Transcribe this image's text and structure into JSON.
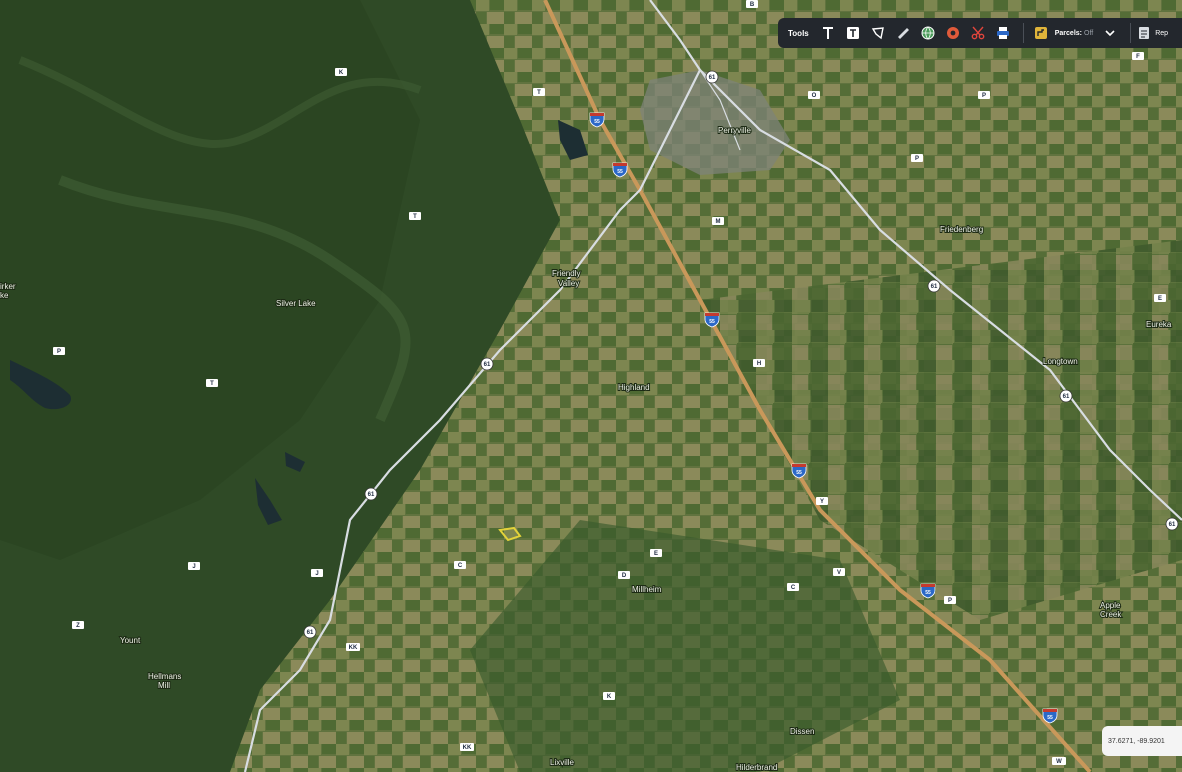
{
  "toolbar": {
    "tools_label": "Tools",
    "parcels_label": "Parcels:",
    "parcels_state": "Off",
    "report_label": "Rep"
  },
  "coords": {
    "text": "37.6271, -89.9201"
  },
  "places": {
    "perryville": "Perryville",
    "friedenberg": "Friedenberg",
    "friendly_valley_1": "Friendly",
    "friendly_valley_2": "Valley",
    "silver_lake": "Silver Lake",
    "highland": "Highland",
    "longtown": "Longtown",
    "eureka": "Eureka",
    "walker_1": "irker",
    "walker_2": "ke",
    "millheim": "Millheim",
    "hellmans_mill_1": "Hellmans",
    "hellmans_mill_2": "Mill",
    "yount": "Yount",
    "apple_creek_1": "Apple",
    "apple_creek_2": "Creek",
    "dissen": "Dissen",
    "lixville": "Lixville",
    "hilderbrand": "Hilderbrand"
  },
  "shields": {
    "i55_1": "55",
    "i55_2": "55",
    "i55_3": "55",
    "i55_4": "55",
    "i55_5": "55",
    "i55_6": "55",
    "us61_1": "61",
    "us61_2": "61",
    "us61_3": "61",
    "us61_4": "61",
    "us61_5": "61",
    "us61_6": "61",
    "us61_7": "61",
    "k": "K",
    "t_top": "T",
    "t_mid": "T",
    "p_left": "P",
    "t_left": "T",
    "j_left": "J",
    "j_left2": "J",
    "z_left": "Z",
    "kk": "KK",
    "c_mid": "C",
    "e_mid": "E",
    "d_mid": "D",
    "b_top": "B",
    "o_top": "O",
    "p_top": "P",
    "p_right": "P",
    "m_mid": "M",
    "h_mid": "H",
    "y_mid": "Y",
    "c_low": "C",
    "kk_low": "KK",
    "v": "V",
    "p_low": "P",
    "e_right": "E",
    "f_top": "F",
    "k_low": "K",
    "w": "W"
  },
  "colors": {
    "forest": "#2f4a26",
    "farmland": "#6b7a4a",
    "lake": "#1d2e33",
    "interstate": "#c9985a",
    "highway": "#d8dde2",
    "town": "#7d8378",
    "parcel_outline": "#e3d23a",
    "toolbar_bg": "#23272d",
    "record_red": "#e05a3a",
    "scissors_red": "#e0453c",
    "shield_blue": "#2b68c8"
  },
  "icons": [
    "text-icon",
    "text-box-icon",
    "polygon-icon",
    "ruler-icon",
    "globe-icon",
    "record-icon",
    "scissors-icon",
    "print-icon",
    "parcels-icon",
    "chevron-down-icon",
    "report-icon"
  ]
}
